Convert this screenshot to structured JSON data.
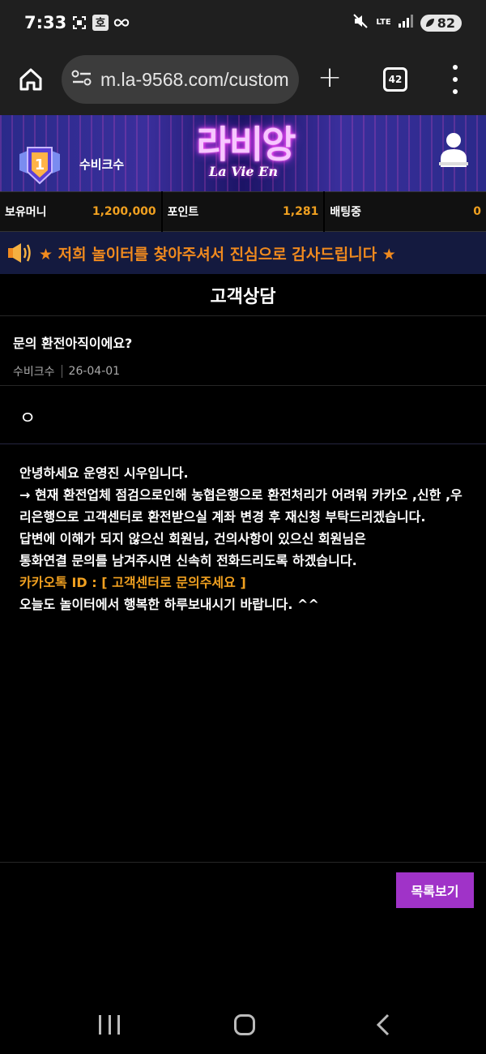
{
  "status_bar": {
    "time": "7:33",
    "ho_badge": "호",
    "network": "LTE",
    "battery": "82"
  },
  "browser": {
    "url": "m.la-9568.com/custom",
    "tab_count": "42"
  },
  "site": {
    "logo_text": "라비앙",
    "logo_subtext": "La Vie En",
    "username": "수비크수",
    "rank_number": "1"
  },
  "balances": [
    {
      "label": "보유머니",
      "value": "1,200,000"
    },
    {
      "label": "포인트",
      "value": "1,281"
    },
    {
      "label": "배팅중",
      "value": "0"
    }
  ],
  "notice": {
    "text": "★ 저희 놀이터를 찾아주셔서 진심으로 감사드립니다 ★"
  },
  "page": {
    "title": "고객상담"
  },
  "post": {
    "subject": "문의 환전아직이에요?",
    "author": "수비크수",
    "date": "26-04-01",
    "question_body": "ㅇ"
  },
  "answer": {
    "greeting": "안녕하세요 운영진 시우입니다.",
    "notice": "→ 현재 환전업체 점검으로인해 농협은행으로 환전처리가 어려워 카카오 ,신한 ,우리은행으로 고객센터로 환전받으실 계좌 변경 후 재신청 부탁드리겠습니다.",
    "question_line1": "답변에 이해가 되지 않으신 회원님, 건의사항이 있으신 회원님은",
    "question_line2": "통화연결 문의를 남겨주시면 신속히 전화드리도록 하겠습니다.",
    "kakao": "카카오톡 ID : [ 고객센터로 문의주세요 ]",
    "farewell": "오늘도 놀이터에서 행복한 하루보내시기 바랍니다. ^^"
  },
  "buttons": {
    "list": "목록보기"
  },
  "colors": {
    "accent_orange": "#f0a020",
    "button_purple": "#a033c8",
    "notice_bg": "#141a3f"
  }
}
